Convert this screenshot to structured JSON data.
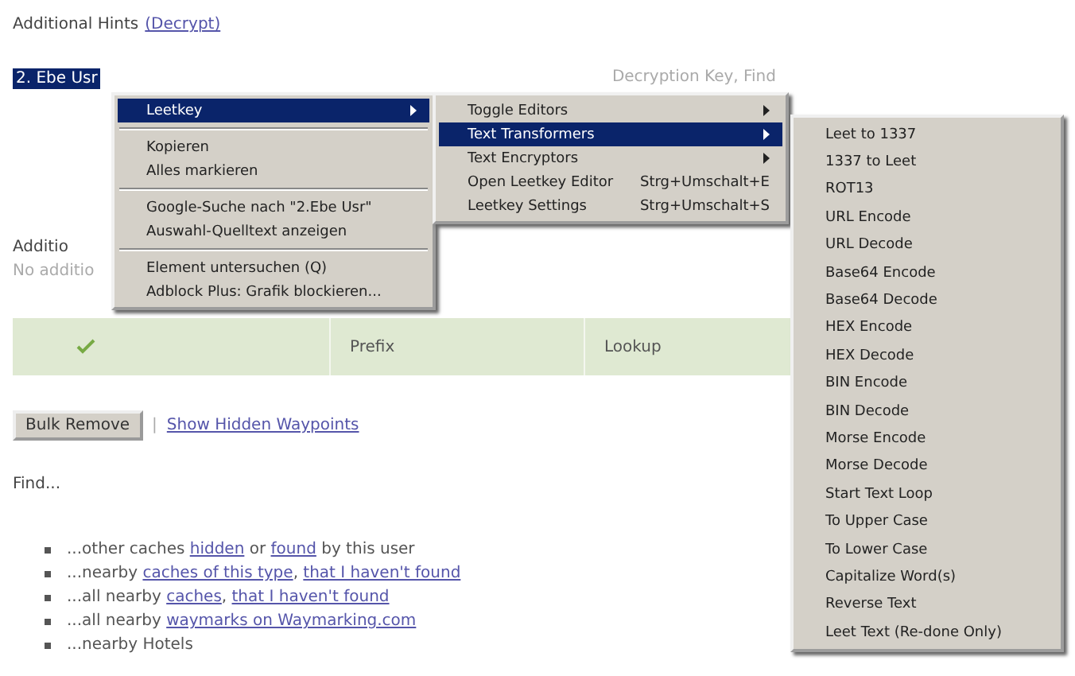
{
  "hints": {
    "title": "Additional Hints",
    "link": "(Decrypt)",
    "selected_text": "2. Ebe Usr",
    "key_label": "Decryption Key, Find"
  },
  "context_menu": {
    "items": [
      {
        "kind": "submenu",
        "label": "Leetkey",
        "selected": true
      },
      {
        "kind": "separator"
      },
      {
        "kind": "item",
        "label": "Kopieren",
        "selected": false
      },
      {
        "kind": "item",
        "label": "Alles markieren",
        "selected": false
      },
      {
        "kind": "separator"
      },
      {
        "kind": "item",
        "label": "Google-Suche nach \"2.Ebe Usr\"",
        "selected": false
      },
      {
        "kind": "item",
        "label": "Auswahl-Quelltext anzeigen",
        "selected": false
      },
      {
        "kind": "separator"
      },
      {
        "kind": "item",
        "label": "Element untersuchen (Q)",
        "selected": false
      },
      {
        "kind": "item",
        "label": "Adblock Plus: Grafik blockieren...",
        "selected": false
      }
    ]
  },
  "leetkey_menu": {
    "items": [
      {
        "kind": "submenu",
        "label": "Toggle Editors",
        "selected": false
      },
      {
        "kind": "submenu",
        "label": "Text Transformers",
        "selected": true
      },
      {
        "kind": "submenu",
        "label": "Text Encryptors",
        "selected": false
      },
      {
        "kind": "item",
        "label": "Open Leetkey Editor",
        "shortcut": "Strg+Umschalt+E",
        "selected": false
      },
      {
        "kind": "item",
        "label": "Leetkey Settings",
        "shortcut": "Strg+Umschalt+S",
        "selected": false
      }
    ]
  },
  "transformers_menu": {
    "items": [
      "Leet to 1337",
      "1337 to Leet",
      "ROT13",
      "URL Encode",
      "URL Decode",
      "Base64 Encode",
      "Base64 Decode",
      "HEX Encode",
      "HEX Decode",
      "BIN Encode",
      "BIN Decode",
      "Morse Encode",
      "Morse Decode",
      "Start Text Loop",
      "To Upper Case",
      "To Lower Case",
      "Capitalize Word(s)",
      "Reverse Text",
      "Leet Text (Re-done Only)"
    ]
  },
  "additional_section": {
    "title": "Additio",
    "text": "No additio"
  },
  "table": {
    "columns": [
      {
        "kind": "check"
      },
      {
        "kind": "text",
        "label": "Prefix"
      },
      {
        "kind": "text",
        "label": "Lookup"
      }
    ]
  },
  "actions": {
    "button": "Bulk Remove",
    "separator": "|",
    "link": "Show Hidden Waypoints"
  },
  "find": {
    "title": "Find...",
    "items": [
      [
        {
          "text": "...other caches ",
          "link": false
        },
        {
          "text": "hidden",
          "link": true
        },
        {
          "text": " or ",
          "link": false
        },
        {
          "text": "found",
          "link": true
        },
        {
          "text": " by this user",
          "link": false
        }
      ],
      [
        {
          "text": "...nearby ",
          "link": false
        },
        {
          "text": "caches of this type",
          "link": true,
          "after": ", "
        },
        {
          "text": "that I haven't found",
          "link": true
        }
      ],
      [
        {
          "text": "...all nearby ",
          "link": false
        },
        {
          "text": "caches",
          "link": true,
          "after": ", "
        },
        {
          "text": "that I haven't found",
          "link": true
        }
      ],
      [
        {
          "text": "...all nearby ",
          "link": false
        },
        {
          "text": "waymarks on Waymarking.com",
          "link": true
        }
      ],
      [
        {
          "text": "...nearby Hotels",
          "link": false
        }
      ]
    ]
  }
}
